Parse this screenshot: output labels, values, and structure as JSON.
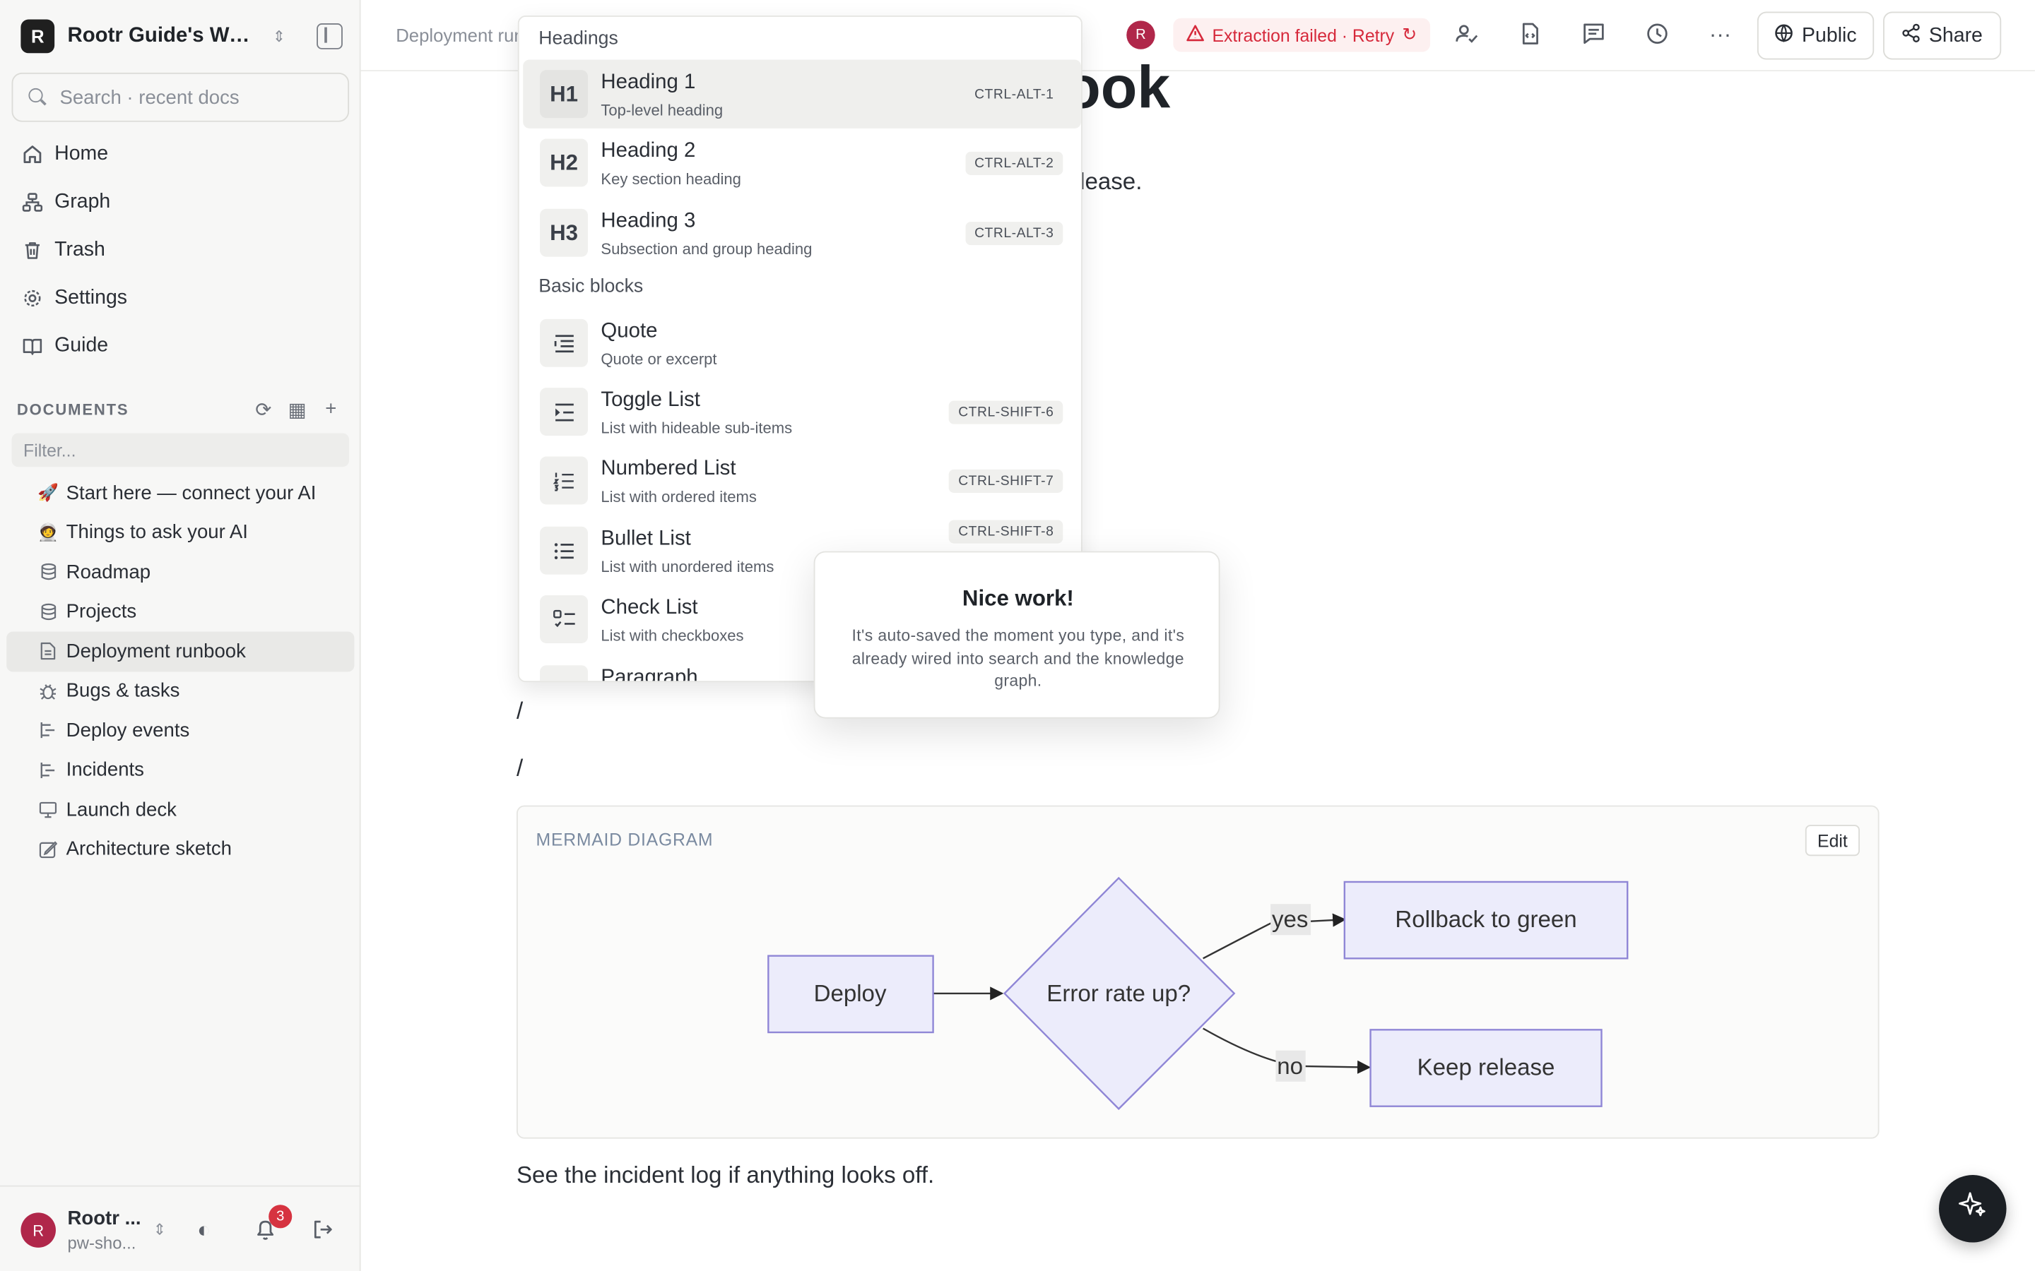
{
  "workspace": {
    "badge": "R",
    "name": "Rootr Guide's Workspace"
  },
  "search": {
    "placeholder": "Search · recent docs"
  },
  "nav": [
    {
      "label": "Home",
      "icon": "home-icon"
    },
    {
      "label": "Graph",
      "icon": "graph-icon"
    },
    {
      "label": "Trash",
      "icon": "trash-icon"
    },
    {
      "label": "Settings",
      "icon": "gear-icon"
    },
    {
      "label": "Guide",
      "icon": "book-icon"
    }
  ],
  "documents": {
    "label": "DOCUMENTS",
    "filter_placeholder": "Filter...",
    "items": [
      {
        "label": "Start here — connect your AI",
        "icon": "🚀"
      },
      {
        "label": "Things to ask your AI",
        "icon": "🧑‍🚀"
      },
      {
        "label": "Roadmap",
        "icon": "database-icon"
      },
      {
        "label": "Projects",
        "icon": "database-icon"
      },
      {
        "label": "Deployment runbook",
        "icon": "page-icon",
        "active": true
      },
      {
        "label": "Bugs & tasks",
        "icon": "bug-icon"
      },
      {
        "label": "Deploy events",
        "icon": "timeline-icon"
      },
      {
        "label": "Incidents",
        "icon": "timeline-icon"
      },
      {
        "label": "Launch deck",
        "icon": "presentation-icon"
      },
      {
        "label": "Architecture sketch",
        "icon": "sketch-icon"
      }
    ]
  },
  "user": {
    "avatar": "R",
    "name": "Rootr ...",
    "sub": "pw-sho...",
    "notifications": "3"
  },
  "topbar": {
    "breadcrumb": "Deployment runbook",
    "avatar": "R",
    "extraction_status": "Extraction failed · Retry",
    "public_label": "Public",
    "share_label": "Share"
  },
  "doc": {
    "title": "ook",
    "intro": "elease.",
    "slash_1": "/",
    "slash_2": "/",
    "footer_text": "See the incident log if anything looks off."
  },
  "mermaid": {
    "label": "MERMAID DIAGRAM",
    "edit_label": "Edit",
    "nodes": {
      "deploy": "Deploy",
      "decision": "Error rate up?",
      "rollback": "Rollback to green",
      "keep": "Keep release"
    },
    "edges": {
      "yes": "yes",
      "no": "no"
    }
  },
  "slash_menu": {
    "section_headings": "Headings",
    "section_basic": "Basic blocks",
    "items": [
      {
        "icon": "H1",
        "title": "Heading 1",
        "sub": "Top-level heading",
        "kbd": "CTRL-ALT-1",
        "highlighted": true
      },
      {
        "icon": "H2",
        "title": "Heading 2",
        "sub": "Key section heading",
        "kbd": "CTRL-ALT-2"
      },
      {
        "icon": "H3",
        "title": "Heading 3",
        "sub": "Subsection and group heading",
        "kbd": "CTRL-ALT-3"
      },
      {
        "icon": "quote-icon",
        "title": "Quote",
        "sub": "Quote or excerpt",
        "kbd": ""
      },
      {
        "icon": "toggle-list-icon",
        "title": "Toggle List",
        "sub": "List with hideable sub-items",
        "kbd": "CTRL-SHIFT-6"
      },
      {
        "icon": "numbered-list-icon",
        "title": "Numbered List",
        "sub": "List with ordered items",
        "kbd": "CTRL-SHIFT-7"
      },
      {
        "icon": "bullet-list-icon",
        "title": "Bullet List",
        "sub": "List with unordered items",
        "kbd": "CTRL-SHIFT-8"
      },
      {
        "icon": "check-list-icon",
        "title": "Check List",
        "sub": "List with checkboxes",
        "kbd": ""
      },
      {
        "icon": "paragraph-icon",
        "title": "Paragraph",
        "sub": "",
        "kbd": ""
      }
    ]
  },
  "toast": {
    "title": "Nice work!",
    "body": "It's auto-saved the moment you type, and it's already wired into search and the knowledge graph."
  },
  "colors": {
    "accent_error": "#d6293b",
    "avatar": "#b0274a",
    "diagram_fill": "#ececfb",
    "diagram_stroke": "#8f86d6"
  }
}
